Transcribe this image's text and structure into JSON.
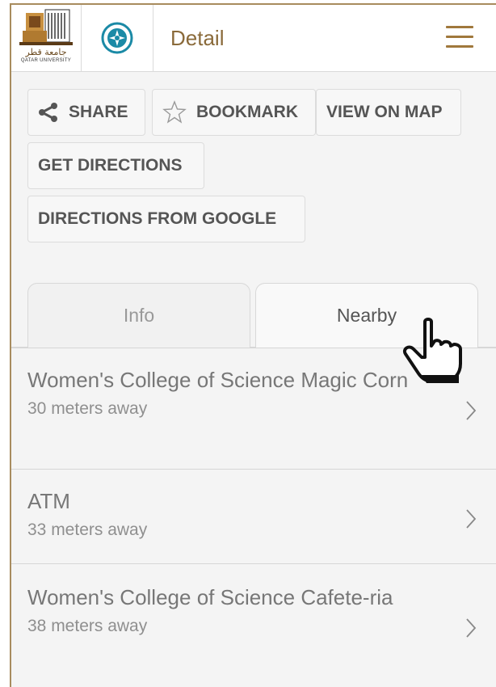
{
  "header": {
    "logo_arabic": "جامعة قطر",
    "logo_english": "QATAR UNIVERSITY",
    "title": "Detail"
  },
  "actions": {
    "share": "SHARE",
    "bookmark": "BOOKMARK",
    "view_on_map": "VIEW ON MAP",
    "get_directions": "GET DIRECTIONS",
    "directions_from_google": "DIRECTIONS FROM GOOGLE"
  },
  "tabs": [
    {
      "label": "Info",
      "active": false
    },
    {
      "label": "Nearby",
      "active": true
    }
  ],
  "nearby": [
    {
      "name": "Women's College of Science Magic Corn",
      "distance": "30 meters away"
    },
    {
      "name": "ATM",
      "distance": "33 meters away"
    },
    {
      "name": "Women's College of Science Cafete-ria",
      "distance": "38 meters away"
    }
  ],
  "colors": {
    "accent_gold": "#8a6a3a",
    "menu_icon": "#a0783c",
    "compass_teal": "#1b8aa6"
  }
}
